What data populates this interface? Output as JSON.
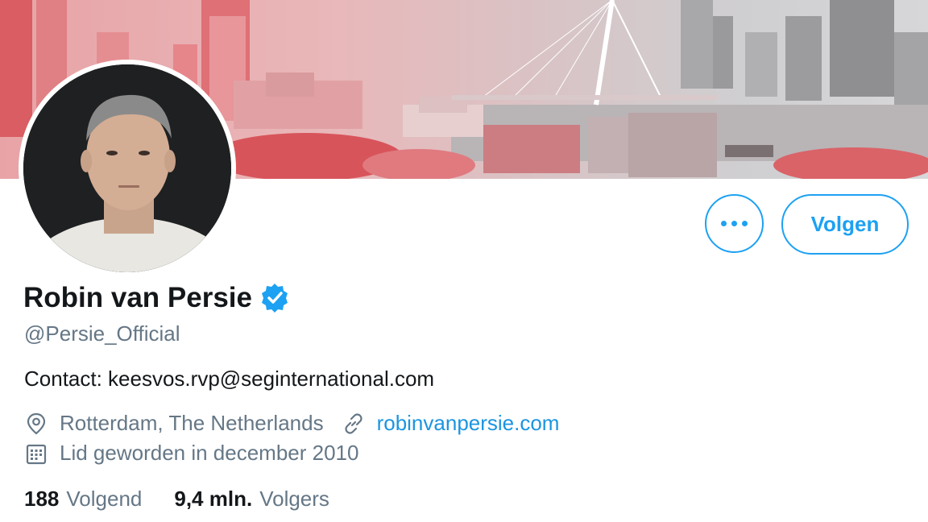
{
  "profile": {
    "name": "Robin van Persie",
    "handle": "@Persie_Official",
    "bio": "Contact: keesvos.rvp@seginternational.com",
    "location": "Rotterdam, The Netherlands",
    "website": "robinvanpersie.com",
    "joined": "Lid geworden in december 2010"
  },
  "actions": {
    "follow_label": "Volgen"
  },
  "stats": {
    "following_count": "188",
    "following_label": "Volgend",
    "followers_count": "9,4 mln.",
    "followers_label": "Volgers"
  },
  "colors": {
    "accent": "#1da1f2",
    "link": "#1b95e0",
    "secondary_text": "#657786",
    "primary_text": "#14171a"
  },
  "icons": {
    "location": "location-pin-icon",
    "website": "link-icon",
    "joined": "calendar-icon",
    "verified": "verified-badge-icon",
    "more": "more-options-icon"
  }
}
